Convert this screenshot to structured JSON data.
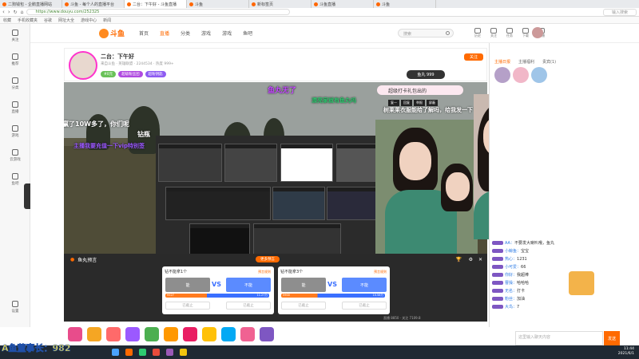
{
  "browser": {
    "tabs": [
      {
        "label": "二狗钱包 - 企鹅直播网站"
      },
      {
        "label": "斗鱼 - 每个人的直播平台"
      },
      {
        "label": "二台：下午好 - 斗鱼直播"
      },
      {
        "label": "斗鱼"
      },
      {
        "label": "新标签页"
      },
      {
        "label": "斗鱼直播"
      },
      {
        "label": "斗鱼"
      }
    ],
    "address": "https://www.douyu.com/252325",
    "bookmarks": [
      "收藏",
      "手机收藏夹",
      "谷歌",
      "网址大全",
      "游戏中心",
      "新闻"
    ],
    "search_right": "输入搜索"
  },
  "sidebar": {
    "items": [
      "关注",
      "推荐",
      "分类",
      "直播",
      "游戏",
      "云游戏",
      "鱼吧"
    ],
    "bottom": "设置"
  },
  "topnav": {
    "logo": "斗鱼",
    "links": [
      "首页",
      "直播",
      "分类",
      "游戏",
      "游戏",
      "鱼吧"
    ],
    "search_placeholder": "搜索",
    "icons": [
      "历史",
      "关注",
      "任务",
      "下载",
      "开播"
    ]
  },
  "room": {
    "title": "二台：下午好",
    "subtitle": "来自斗鱼 · 英雄联盟 · 2244534 · 热度 999+",
    "tags": [
      "#0元",
      "超级粉丝团",
      "超粉钥匙"
    ],
    "follow": "关注",
    "gift": "鱼丸 999"
  },
  "danmu": [
    {
      "text": "鱼丸无了",
      "color": "#c44bff"
    },
    {
      "text": "超级打卡礼包出的",
      "color": "#333"
    },
    {
      "text": "漂亮家就有鱼丸吗",
      "color": "#2ecc71"
    },
    {
      "text": "树莱莱衣服能给了解吗，给我发一下",
      "color": "#ffffff"
    },
    {
      "text": "赢了10W多了，你们呢",
      "color": "#ffffff"
    },
    {
      "text": "钻瓶",
      "color": "#ffffff"
    },
    {
      "text": "主播我要充值一下vip特别签",
      "color": "#9b59ff"
    }
  ],
  "chat_buttons": [
    "复一",
    "回复",
    "举报",
    "屏蔽"
  ],
  "prediction": {
    "title": "鱼丸预言",
    "badge": "更多预言",
    "cards": [
      {
        "question": "钻不能拿1个",
        "link": "预言规则",
        "opt_a": "能",
        "opt_b": "不能",
        "n_a": "9527",
        "n_b": "11.27万",
        "btn_a": "已截止",
        "btn_b": "已截止"
      },
      {
        "question": "钻不能拿3个",
        "link": "预言规则",
        "opt_a": "能",
        "opt_b": "不能",
        "n_a": "5900",
        "n_b": "10.58万",
        "btn_a": "已截止",
        "btn_b": "已截止"
      }
    ]
  },
  "right": {
    "tabs": [
      "主播日报",
      "主播福利",
      "贵宾(1)"
    ],
    "chat": [
      {
        "lv": "",
        "user": "AA：",
        "text": "不要发大喇叭哦，鱼丸"
      },
      {
        "lv": "",
        "user": "小鲸鱼：",
        "text": "宝宝"
      },
      {
        "lv": "",
        "user": "热心：",
        "text": "1231"
      },
      {
        "lv": "",
        "user": "小可爱：",
        "text": "66"
      },
      {
        "lv": "",
        "user": "你好：",
        "text": "我超棒"
      },
      {
        "lv": "",
        "user": "曹操：",
        "text": "哈哈哈"
      },
      {
        "lv": "",
        "user": "无名：",
        "text": "打卡"
      },
      {
        "lv": "",
        "user": "粉丝：",
        "text": "加油"
      },
      {
        "lv": "",
        "user": "大鸟：",
        "text": "7"
      }
    ],
    "input_placeholder": "这里输入聊天内容",
    "send": "发送"
  },
  "stream_info": {
    "left": "直播 8850",
    "right": "关注 7109.8"
  },
  "taskbar": {
    "time": "11:44",
    "date": "2021/6/1"
  },
  "watermark": "A鱼董事长：982"
}
